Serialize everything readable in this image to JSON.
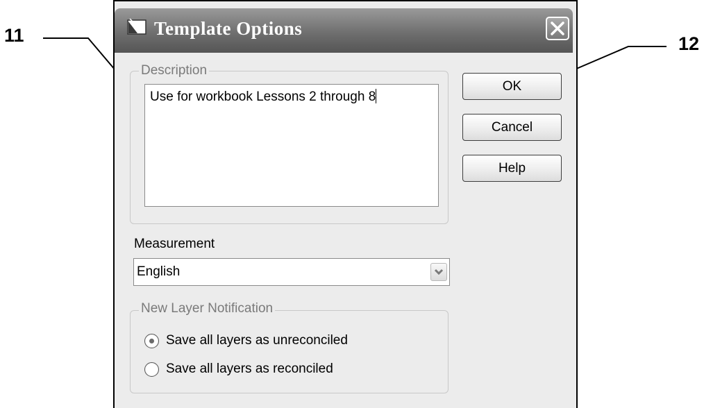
{
  "callouts": {
    "left": "11",
    "right": "12"
  },
  "window": {
    "title": "Template Options"
  },
  "description": {
    "legend": "Description",
    "value": "Use for workbook Lessons 2 through 8"
  },
  "buttons": {
    "ok": "OK",
    "cancel": "Cancel",
    "help": "Help"
  },
  "measurement": {
    "label": "Measurement",
    "selected": "English"
  },
  "layer_notification": {
    "legend": "New Layer Notification",
    "options": [
      {
        "label": "Save all layers as unreconciled",
        "selected": true
      },
      {
        "label": "Save all layers as reconciled",
        "selected": false
      }
    ]
  },
  "colors": {
    "title_bar": "#6f6f6f",
    "dialog_bg": "#ececec",
    "group_label": "#7a7a7a"
  },
  "icons": [
    "app-icon",
    "close-icon",
    "chevron-down-icon",
    "radio-icon"
  ]
}
